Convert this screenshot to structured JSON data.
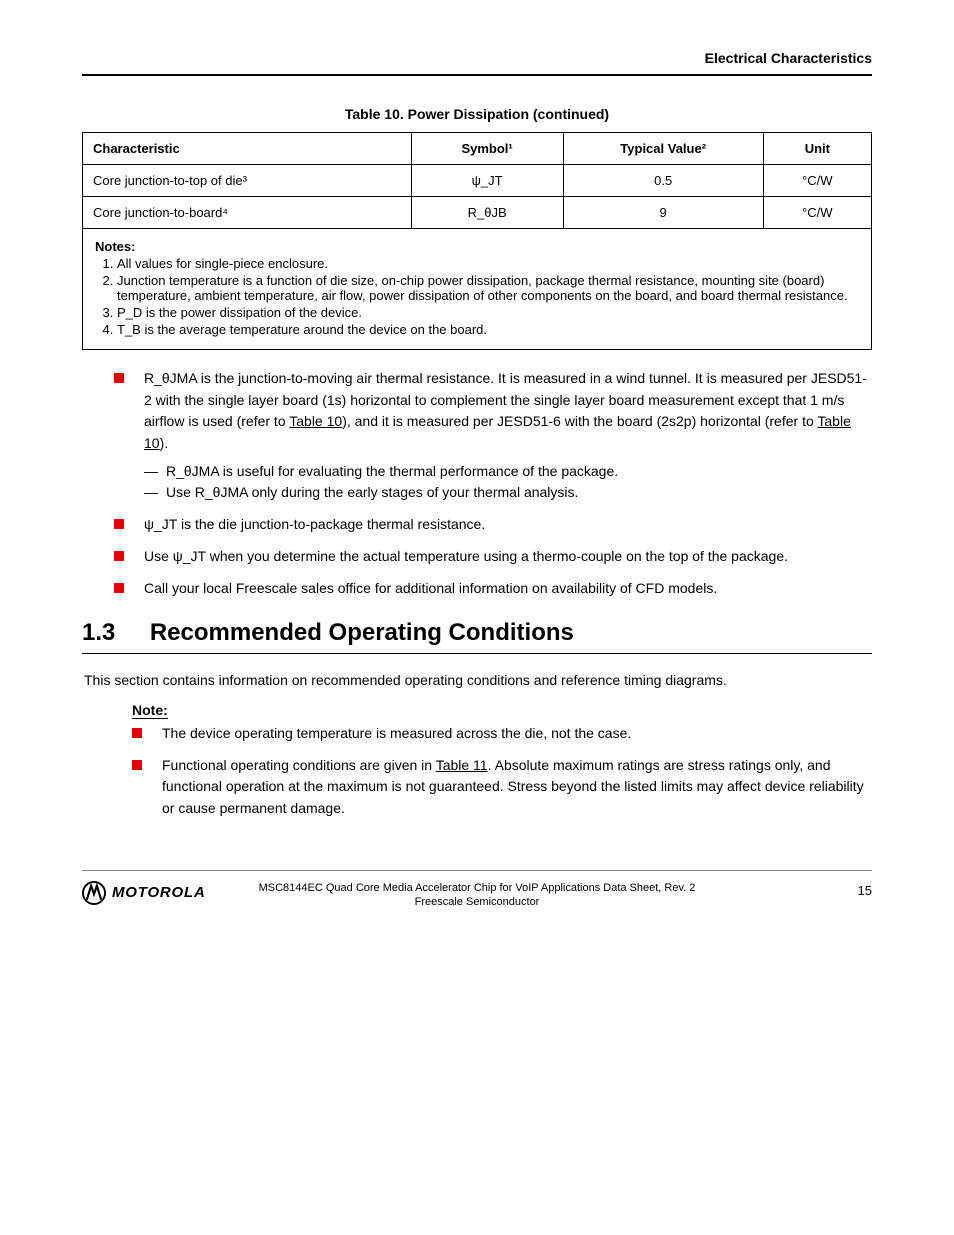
{
  "header": {
    "right": "Electrical Characteristics"
  },
  "table": {
    "caption": "Table 10. Power Dissipation (continued)",
    "headers": [
      "Characteristic",
      "Symbol¹",
      "Typical Value²",
      "Unit"
    ],
    "rows": [
      {
        "c0": "Core junction-to-top of die³",
        "c1": "ψ_JT",
        "c2": "0.5",
        "c3": "°C/W"
      },
      {
        "c0": "Core junction-to-board⁴",
        "c1": "R_θJB",
        "c2": "9",
        "c3": "°C/W"
      }
    ],
    "notes_title": "Notes:",
    "notes": [
      "All values for single-piece enclosure.",
      "Junction temperature is a function of die size, on-chip power dissipation, package thermal resistance, mounting site (board) temperature, ambient temperature, air flow, power dissipation of other components on the board, and board thermal resistance.",
      "P_D is the power dissipation of the device.",
      "T_B is the average temperature around the device on the board."
    ]
  },
  "bullets1": [
    {
      "text_parts": [
        "R_θJMA is the junction-to-moving air thermal resistance. It is measured in a wind tunnel. It is measured per JESD51-2 with the single layer board (1s) horizontal to complement the single layer board measurement except that 1 m/s airflow is used (refer to ",
        "Table 10",
        "), and it is measured per JESD51-6 with the board (2s2p) horizontal (refer to ",
        "Table 10",
        ")."
      ],
      "sub": [
        "R_θJMA is useful for evaluating the thermal performance of the package.",
        "Use R_θJMA only during the early stages of your thermal analysis."
      ]
    },
    {
      "text": "ψ_JT is the die junction-to-package thermal resistance."
    },
    {
      "text": "Use ψ_JT when you determine the actual temperature using a thermo-couple on the top of the package."
    },
    {
      "text": "Call your local Freescale sales office for additional information on availability of CFD models."
    }
  ],
  "section": {
    "num": "1.3",
    "title": "Recommended Operating Conditions"
  },
  "body1": "This section contains information on recommended operating conditions and reference timing diagrams.",
  "note": {
    "label": "Note:",
    "bullets": [
      {
        "text": "The device operating temperature is measured across the die, not the case."
      },
      {
        "text_parts": [
          "Functional operating conditions are given in ",
          "Table 11",
          ". Absolute maximum ratings are stress ratings only, and functional operation at the maximum is not guaranteed. Stress beyond the listed limits may affect device reliability or cause permanent damage."
        ]
      }
    ]
  },
  "footer": {
    "line1": "MSC8144EC Quad Core Media Accelerator Chip for VoIP Applications Data Sheet, Rev. 2",
    "line2": "Freescale Semiconductor",
    "page": "15"
  }
}
